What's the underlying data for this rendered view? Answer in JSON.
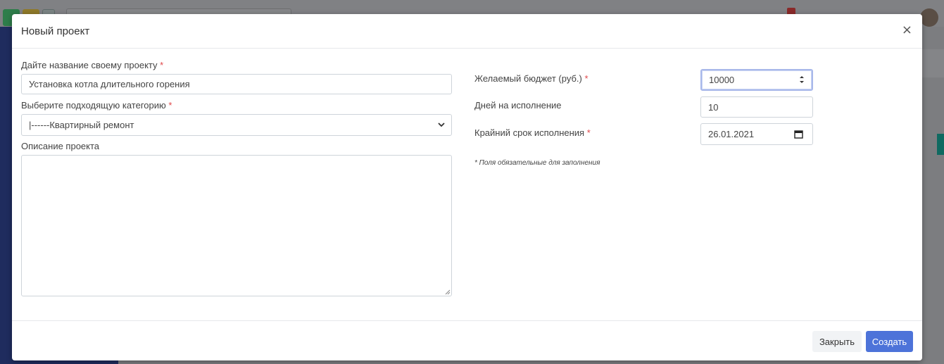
{
  "modal": {
    "title": "Новый проект",
    "close_symbol": "×"
  },
  "form": {
    "name": {
      "label": "Дайте название своему проекту",
      "required_mark": "*",
      "value": "Установка котла длительного горения"
    },
    "category": {
      "label": "Выберите подходящую категорию",
      "required_mark": "*",
      "selected": "|------Квартирный ремонт"
    },
    "description": {
      "label": "Описание проекта",
      "value": ""
    },
    "budget": {
      "label": "Желаемый бюджет (руб.)",
      "required_mark": "*",
      "value": "10000"
    },
    "days": {
      "label": "Дней на исполнение",
      "value": "10"
    },
    "deadline": {
      "label": "Крайний срок исполнения",
      "required_mark": "*",
      "value": "26.01.2021"
    },
    "required_note": "* Поля обязательные для заполнения"
  },
  "footer": {
    "close_label": "Закрыть",
    "create_label": "Создать"
  },
  "colors": {
    "primary": "#4d73d9",
    "required": "#e0484b",
    "sidebar": "#1f2c5e"
  }
}
